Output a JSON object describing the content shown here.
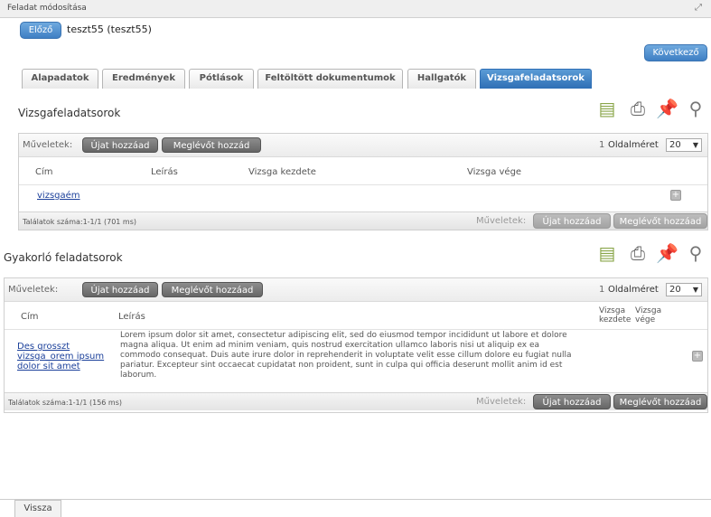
{
  "window": {
    "title": "Feladat módosítása",
    "corner_icon": "resize-icon"
  },
  "nav": {
    "prev_label": "Előző",
    "next_label": "Következő",
    "student": "teszt55 (teszt55)"
  },
  "tabs": [
    {
      "label": "Alapadatok"
    },
    {
      "label": "Eredmények"
    },
    {
      "label": "Pótlások"
    },
    {
      "label": "Feltöltött dokumentumok"
    },
    {
      "label": "Hallgatók"
    },
    {
      "label": "Vizsgafeladatsorok"
    }
  ],
  "section1": {
    "title": "Vizsgafeladatsorok",
    "actions_label": "Műveletek:",
    "add_new": "Újat hozzáad",
    "add_existing": "Meglévőt hozzád",
    "page_num": "1",
    "page_size_label": "Oldalméret",
    "page_size": "20",
    "columns": [
      "Cím",
      "Leírás",
      "Vizsga kezdete",
      "Vizsga vége"
    ],
    "rows": [
      {
        "title": "vizsgaém"
      }
    ],
    "results": "Találatok száma:1-1/1 (701 ms)",
    "footer_actions_label": "Műveletek:",
    "footer_add_new": "Újat hozzáad",
    "footer_add_existing": "Meglévőt hozzáad"
  },
  "section2": {
    "title": "Gyakorló feladatsorok",
    "actions_label": "Műveletek:",
    "add_new": "Újat hozzáad",
    "add_existing": "Meglévőt hozzáad",
    "page_num": "1",
    "page_size_label": "Oldalméret",
    "page_size": "20",
    "columns": [
      "Cím",
      "Leírás",
      "Vizsga kezdete",
      "Vizsga vége"
    ],
    "rows": [
      {
        "title_l1": "Des grosszt",
        "title_l2": "vizsga_orem ipsum",
        "title_l3": "dolor sit amet",
        "desc_l1": "Lorem ipsum dolor sit amet, consectetur adipiscing elit, sed do eiusmod tempor incididunt ut labore et dolore",
        "desc_l2": "magna aliqua. Ut enim ad minim veniam, quis nostrud exercitation ullamco laboris nisi ut aliquip ex ea",
        "desc_l3": "commodo consequat. Duis aute irure dolor in reprehenderit in voluptate velit esse cillum dolore eu fugiat nulla",
        "desc_l4": "pariatur. Excepteur sint occaecat cupidatat non proident, sunt in culpa qui officia deserunt mollit anim id est",
        "desc_l5": "laborum."
      }
    ],
    "results": "Találatok száma:1-1/1 (156 ms)",
    "footer_actions_label": "Műveletek:",
    "footer_add_new": "Újat hozzáad",
    "footer_add_existing": "Meglévőt hozzáad"
  },
  "toolbar_icons": [
    "document-icon",
    "print-icon",
    "pin-icon",
    "search-icon"
  ],
  "back_label": "Vissza"
}
